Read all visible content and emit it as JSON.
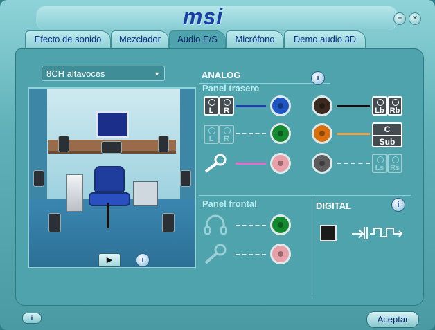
{
  "window": {
    "logo_text": "msi",
    "minimize_label": "–",
    "close_label": "×"
  },
  "tabs": [
    {
      "label": "Efecto de sonido",
      "active": false
    },
    {
      "label": "Mezclador",
      "active": false
    },
    {
      "label": "Audio E/S",
      "active": true
    },
    {
      "label": "Micrófono",
      "active": false
    },
    {
      "label": "Demo audio 3D",
      "active": false
    }
  ],
  "speaker_config": {
    "selected": "8CH altavoces"
  },
  "analog": {
    "title": "ANALOG",
    "rear_panel_label": "Panel trasero",
    "front_panel_label": "Panel frontal",
    "rear_left_icons": [
      [
        "L",
        "R"
      ],
      [
        "L",
        "R"
      ]
    ],
    "rear_right_icons": {
      "top": [
        "Lb",
        "Rb"
      ],
      "middle": [
        "C",
        "Sub"
      ],
      "bottom": [
        "Ls",
        "Rs"
      ]
    },
    "jack_colors": {
      "blue": "#1f56c4",
      "green": "#138a2f",
      "pink": "#e8a0a8",
      "black": "#3a2a20",
      "orange": "#d9700f",
      "gray": "#5c5c5c",
      "cable_blue": "#1f3fa8",
      "cable_black": "#111111",
      "cable_orange": "#f0a040",
      "cable_pink": "#e070d0"
    }
  },
  "digital": {
    "title": "DIGITAL"
  },
  "buttons": {
    "info_label": "i",
    "play_label": "▶",
    "accept_label": "Aceptar",
    "bottom_icon_label": "i"
  }
}
